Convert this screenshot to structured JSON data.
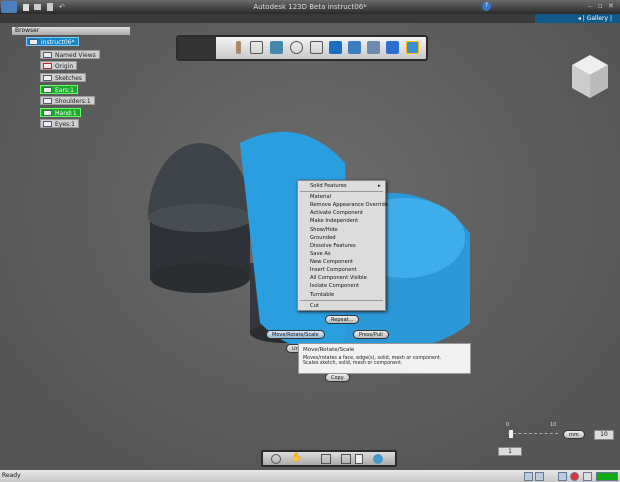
{
  "title": "Autodesk 123D Beta   instruct06*",
  "gallery": "◂ | Gallery |",
  "browser": {
    "title": "Browser",
    "root": "instruct06*",
    "items": [
      "Named Views",
      "Origin",
      "Sketches",
      "Ears:1",
      "Shoulders:1",
      "Hand:1",
      "Eyes:1"
    ]
  },
  "context_menu": {
    "items": [
      "Solid Features",
      "Material",
      "Remove Appearance Override",
      "Activate Component",
      "Make Independent",
      "Show/Hide",
      "Grounded",
      "Dissolve Features",
      "Save As",
      "New Component",
      "Insert Component",
      "All Component Visible",
      "Isolate Component",
      "Turntable",
      "Cut"
    ]
  },
  "marking": {
    "repeat": "Repeat...",
    "move": "Move/Rotate/Scale",
    "presspull": "Press/Pull",
    "undo": "Un",
    "copy": "Copy"
  },
  "tooltip": {
    "title": "Move/Rotate/Scale",
    "line1": "Moves/rotates a face, edge(s), solid, mesh or component.",
    "line2": "Scales sketch, solid, mesh or component."
  },
  "scale": {
    "min": "0",
    "max": "10",
    "unit": "mm",
    "value": "10",
    "current": "1"
  },
  "status": "Ready",
  "colors": {
    "selection": "#2a9fe0",
    "accent": "#1585c8"
  }
}
